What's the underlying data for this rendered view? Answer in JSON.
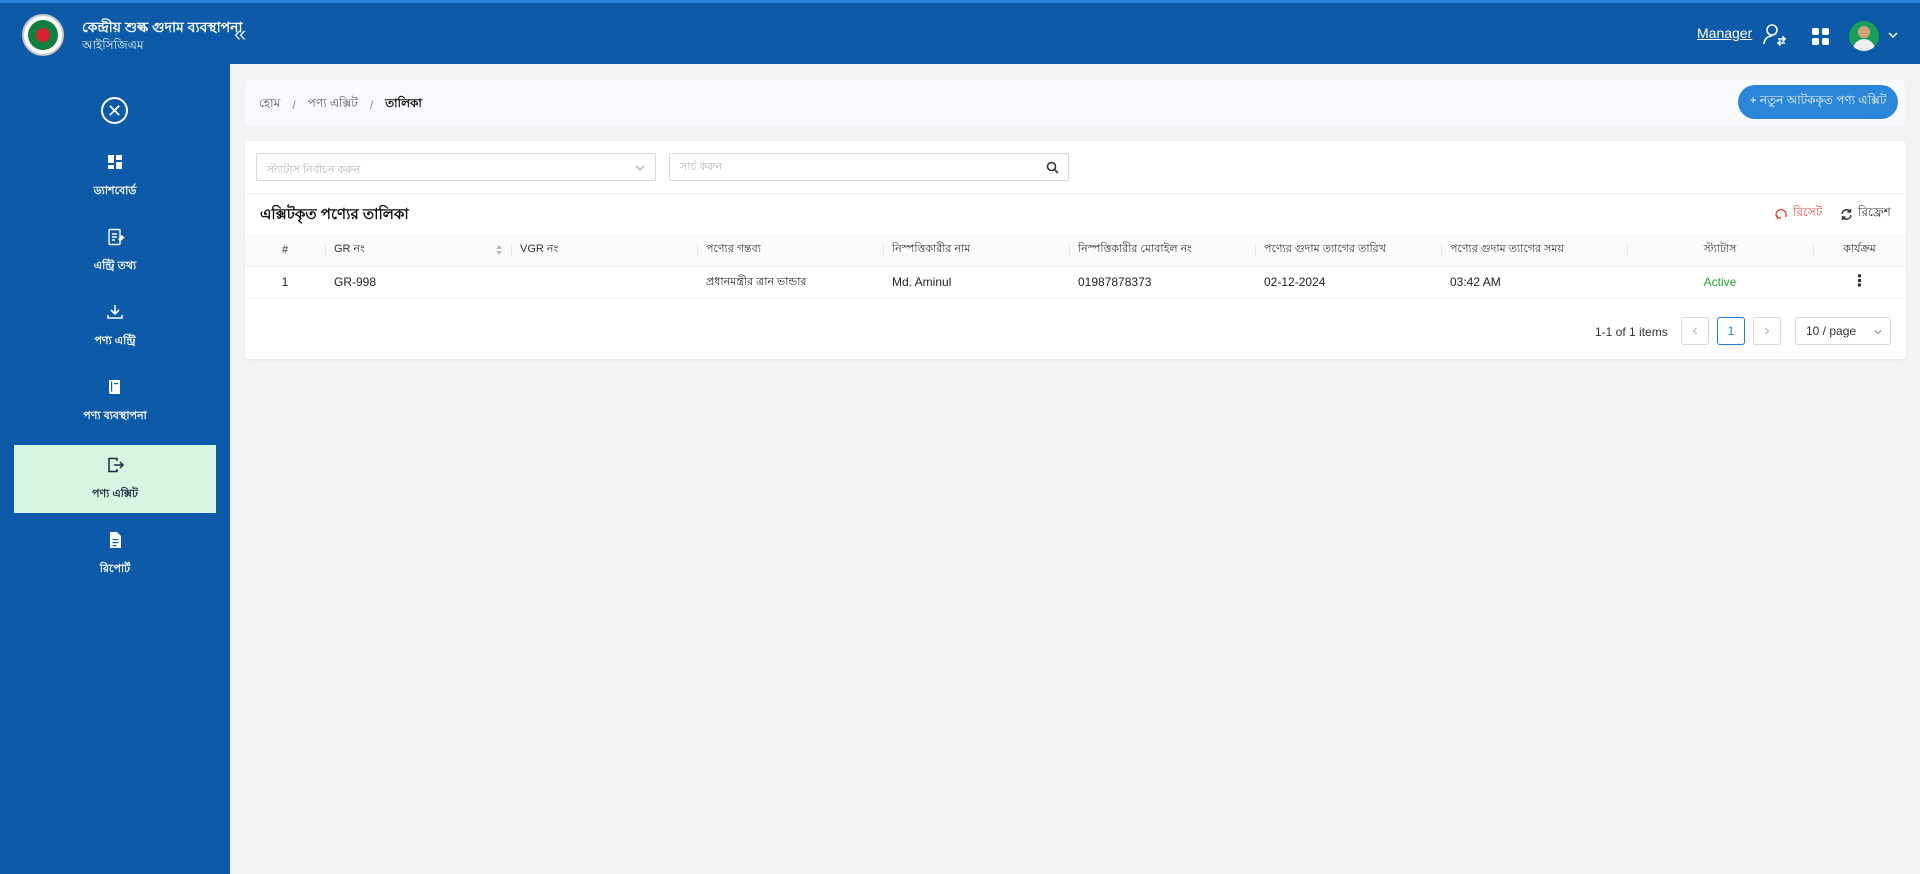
{
  "header": {
    "app_name": "কেন্দ্রীয় শুল্ক গুদাম ব্যবস্থাপনা",
    "app_subtitle": "আইসিজিএম",
    "role": "Manager"
  },
  "sidebar": {
    "items": [
      {
        "label": "ড্যাশবোর্ড",
        "icon": "dashboard-icon"
      },
      {
        "label": "এন্ট্রি তথ্য",
        "icon": "entry-info-icon"
      },
      {
        "label": "পণ্য এন্ট্রি",
        "icon": "download-icon"
      },
      {
        "label": "পণ্য ব্যবস্থাপনা",
        "icon": "book-icon"
      },
      {
        "label": "পণ্য এক্সিট",
        "icon": "exit-icon"
      },
      {
        "label": "রিপোর্ট",
        "icon": "report-icon"
      }
    ],
    "active_index": 4
  },
  "breadcrumb": {
    "items": [
      "হোম",
      "পণ্য এক্সিট",
      "তালিকা"
    ]
  },
  "actions": {
    "new_button": "+ নতুন আটককৃত পণ্য এক্সিট"
  },
  "filters": {
    "status_placeholder": "স্ট্যাটাস নির্বাচন করুন",
    "search_placeholder": "সার্চ করুন"
  },
  "list": {
    "title": "এক্সিটকৃত পণ্যের তালিকা",
    "reset_label": "রিসেট",
    "refresh_label": "রিফ্রেশ",
    "columns": [
      "#",
      "GR নং",
      "VGR নং",
      "পণ্যের গন্তব্য",
      "নিস্পত্তিকারীর নাম",
      "নিস্পত্তিকারীর মোবাইল নং",
      "পণ্যের গুদাম ত্যাগের তারিখ",
      "পণ্যের গুদাম ত্যাগের সময়",
      "স্ট্যাটাস",
      "কার্যক্রম"
    ],
    "rows": [
      {
        "index": "1",
        "gr_no": "GR-998",
        "vgr_no": "",
        "destination": "প্রধানমন্ত্রীর ত্রান ভান্ডার",
        "settler_name": "Md. Aminul",
        "settler_mobile": "01987878373",
        "exit_date": "02-12-2024",
        "exit_time": "03:42 AM",
        "status": "Active"
      }
    ]
  },
  "pagination": {
    "total_text": "1-1 of 1 items",
    "current_page": "1",
    "page_size": "10 / page"
  },
  "colors": {
    "primary": "#0d5ba8",
    "accent": "#2b85d8",
    "active_nav": "#d6f5e3",
    "status_active": "#2e9e3c",
    "reset": "#e0493e"
  }
}
